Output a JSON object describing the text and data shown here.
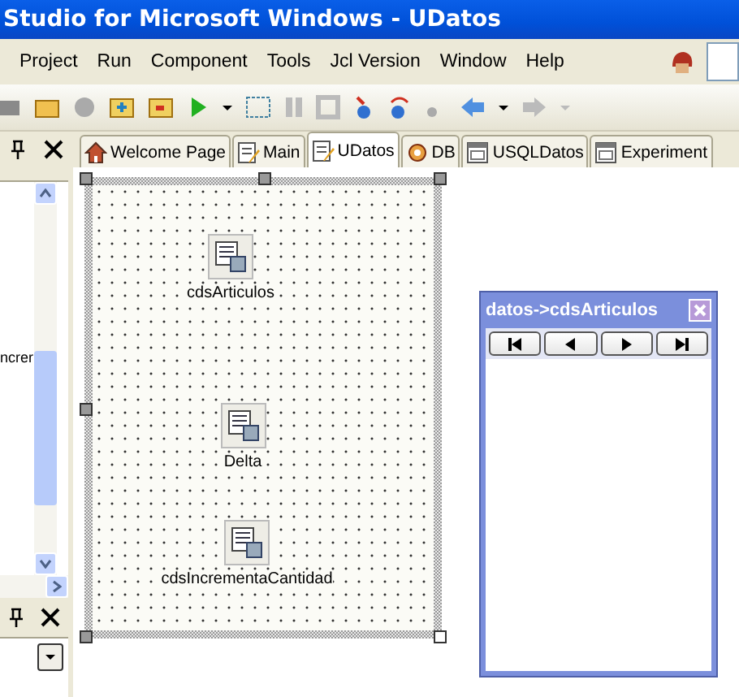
{
  "window": {
    "title": "Studio for Microsoft Windows - UDatos"
  },
  "menu": [
    "Project",
    "Run",
    "Component",
    "Tools",
    "Jcl Version",
    "Window",
    "Help"
  ],
  "tabs": [
    {
      "label": "Welcome Page",
      "selected": false,
      "kind": "home"
    },
    {
      "label": "Main",
      "selected": false,
      "kind": "unit"
    },
    {
      "label": "UDatos",
      "selected": true,
      "kind": "unit"
    },
    {
      "label": "DB",
      "selected": false,
      "kind": "db"
    },
    {
      "label": "USQLDatos",
      "selected": false,
      "kind": "form"
    },
    {
      "label": "Experiment",
      "selected": false,
      "kind": "form"
    }
  ],
  "left_panel": {
    "text": "ncrer"
  },
  "designer": {
    "components": [
      {
        "name": "cdsArticulos"
      },
      {
        "name": "Delta"
      },
      {
        "name": "cdsIncrementaCantidad"
      }
    ]
  },
  "dataset_window": {
    "title": "datos->cdsArticulos"
  }
}
